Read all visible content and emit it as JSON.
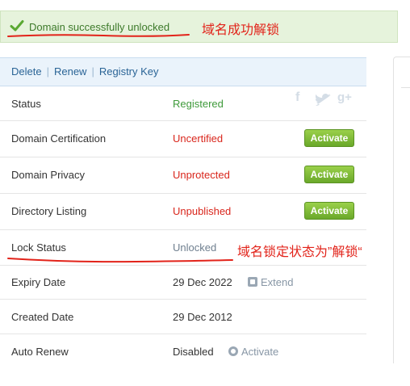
{
  "banner": {
    "message": "Domain successfully unlocked",
    "annotation": "域名成功解锁",
    "icon": "checkmark-icon"
  },
  "toolbar": {
    "delete_label": "Delete",
    "renew_label": "Renew",
    "registry_key_label": "Registry Key",
    "separator": "|"
  },
  "rows": {
    "status": {
      "label": "Status",
      "value": "Registered"
    },
    "certification": {
      "label": "Domain Certification",
      "value": "Uncertified",
      "button": "Activate"
    },
    "privacy": {
      "label": "Domain Privacy",
      "value": "Unprotected",
      "button": "Activate"
    },
    "directory": {
      "label": "Directory Listing",
      "value": "Unpublished",
      "button": "Activate"
    },
    "lock": {
      "label": "Lock Status",
      "value": "Unlocked",
      "annotation": "域名锁定状态为”解锁“"
    },
    "expiry": {
      "label": "Expiry Date",
      "value": "29 Dec 2022",
      "action": "Extend"
    },
    "created": {
      "label": "Created Date",
      "value": "29 Dec 2012"
    },
    "auto_renew": {
      "label": "Auto Renew",
      "value": "Disabled",
      "action": "Activate"
    }
  },
  "social": {
    "facebook": "f",
    "twitter_icon": "twitter-bird-icon",
    "google_plus": "g+"
  },
  "colors": {
    "banner_bg": "#e6f3dc",
    "banner_text": "#3d7a2a",
    "annotation_red": "#e2231a",
    "registered_green": "#3e9a3a",
    "warning_red": "#d9261c",
    "button_green": "#7fbf3a",
    "toolbar_bg": "#eaf3fb",
    "link_blue": "#2a6496"
  }
}
